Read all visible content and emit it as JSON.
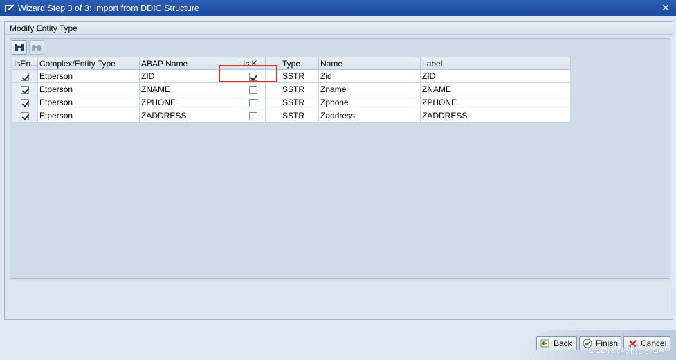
{
  "window": {
    "title": "Wizard Step 3 of 3: Import from DDIC Structure",
    "close_icon": "close-icon"
  },
  "frame": {
    "title": "Modify Entity Type"
  },
  "toolbar": {
    "buttons": [
      {
        "icon": "binoculars-icon",
        "enabled": true
      },
      {
        "icon": "find-next-icon",
        "enabled": false
      }
    ]
  },
  "table": {
    "headers": [
      "IsEn...",
      "Complex/Entity Type",
      "ABAP Name",
      "Is K...",
      "Type",
      "Name",
      "Label"
    ],
    "rows": [
      {
        "is_entity": true,
        "entity_type": "Etperson",
        "abap_name": "ZID",
        "is_key": true,
        "type": "SSTR",
        "name": "Zid",
        "label": "ZID"
      },
      {
        "is_entity": true,
        "entity_type": "Etperson",
        "abap_name": "ZNAME",
        "is_key": false,
        "type": "SSTR",
        "name": "Zname",
        "label": "ZNAME"
      },
      {
        "is_entity": true,
        "entity_type": "Etperson",
        "abap_name": "ZPHONE",
        "is_key": false,
        "type": "SSTR",
        "name": "Zphone",
        "label": "ZPHONE"
      },
      {
        "is_entity": true,
        "entity_type": "Etperson",
        "abap_name": "ZADDRESS",
        "is_key": false,
        "type": "SSTR",
        "name": "Zaddress",
        "label": "ZADDRESS"
      }
    ]
  },
  "buttons": {
    "back": "Back",
    "finish": "Finish",
    "cancel": "Cancel"
  },
  "watermark": "CSDN @外行学SAP",
  "colors": {
    "titlebar": "#2c5db4",
    "highlight": "#e0312f",
    "key_cell": "#fdf0a8"
  }
}
